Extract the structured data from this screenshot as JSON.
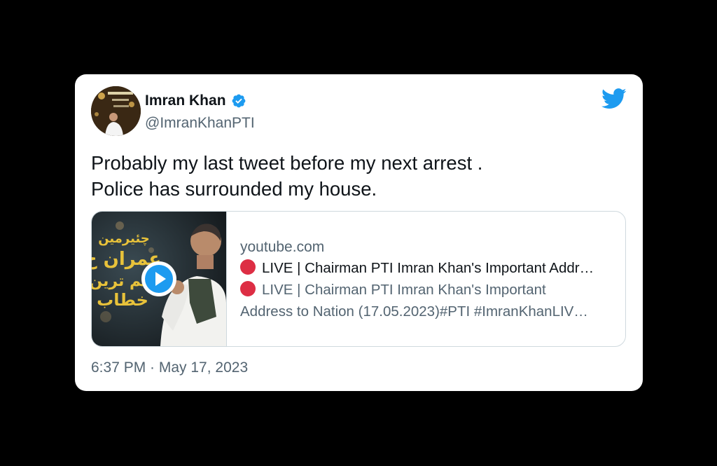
{
  "author": {
    "name": "Imran Khan",
    "handle": "@ImranKhanPTI",
    "verified": true
  },
  "tweet": {
    "line1": "Probably my last tweet before my next arrest .",
    "line2": "Police has surrounded my house."
  },
  "link_card": {
    "domain": "youtube.com",
    "title": "LIVE | Chairman PTI Imran Khan's Important Addr…",
    "desc_line1": "LIVE | Chairman PTI Imran Khan's Important",
    "desc_line2": "Address to Nation (17.05.2023)#PTI #ImranKhanLIV…",
    "thumbnail_text": [
      "چئیرمین",
      "عمران خ",
      "اہم ترین",
      "خطاب"
    ]
  },
  "timestamp": "6:37 PM · May 17, 2023",
  "colors": {
    "twitter_blue": "#1d9bf0",
    "live_dot": "#dd2e44",
    "thumbnail_text": "#e8c23a"
  },
  "icons": {
    "verified": "verified-badge-icon",
    "logo": "twitter-bird-icon",
    "play": "play-icon",
    "live": "red-circle-icon"
  }
}
